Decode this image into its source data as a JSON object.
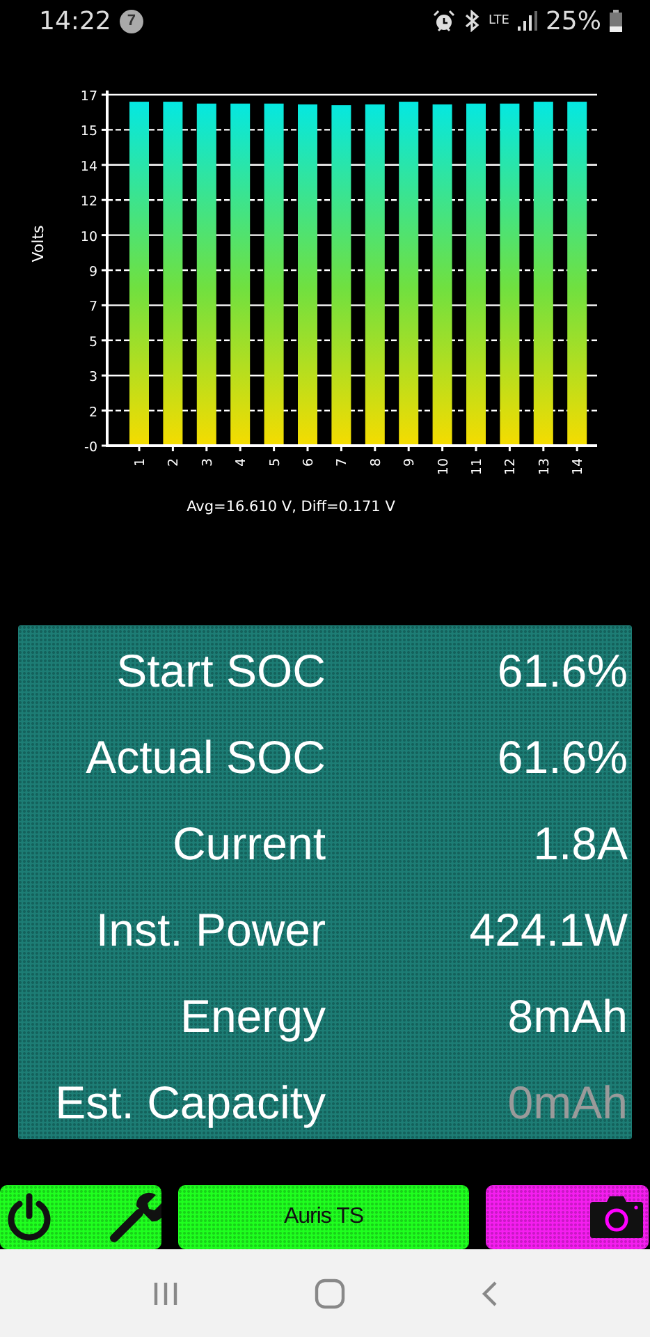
{
  "status_bar": {
    "time": "14:22",
    "notification_count": "7",
    "network": "LTE",
    "battery_text": "25%"
  },
  "chart": {
    "chart_data": {
      "type": "bar",
      "ylabel": "Volts",
      "categories": [
        "1",
        "2",
        "3",
        "4",
        "5",
        "6",
        "7",
        "8",
        "9",
        "10",
        "11",
        "12",
        "13",
        "14"
      ],
      "series": [
        {
          "color": "#00e8e8",
          "values": [
            16.66,
            16.66,
            16.57,
            16.57,
            16.57,
            16.53,
            16.49,
            16.53,
            16.66,
            16.53,
            16.57,
            16.57,
            16.66,
            16.66
          ]
        }
      ],
      "ylim": [
        0,
        17
      ],
      "grid": true,
      "yticks": [
        {
          "value": 0,
          "label": "-0"
        },
        {
          "value": 1.7,
          "label": "2"
        },
        {
          "value": 3.4,
          "label": "3"
        },
        {
          "value": 5.1,
          "label": "5"
        },
        {
          "value": 6.8,
          "label": "7"
        },
        {
          "value": 8.5,
          "label": "9"
        },
        {
          "value": 10.2,
          "label": "10"
        },
        {
          "value": 11.9,
          "label": "12"
        },
        {
          "value": 13.6,
          "label": "14"
        },
        {
          "value": 15.3,
          "label": "15"
        },
        {
          "value": 17,
          "label": "17"
        }
      ]
    },
    "caption": "Avg=16.610 V, Diff=0.171 V"
  },
  "stats": [
    {
      "label": "Start SOC",
      "value": "61.6%",
      "dimmed": false
    },
    {
      "label": "Actual SOC",
      "value": "61.6%",
      "dimmed": false
    },
    {
      "label": "Current",
      "value": "1.8A",
      "dimmed": false
    },
    {
      "label": "Inst. Power",
      "value": "424.1W",
      "dimmed": false
    },
    {
      "label": "Energy",
      "value": "8mAh",
      "dimmed": false
    },
    {
      "label": "Est. Capacity",
      "value": "0mAh",
      "dimmed": true
    }
  ],
  "toolbar": {
    "title_button": "Auris TS"
  }
}
